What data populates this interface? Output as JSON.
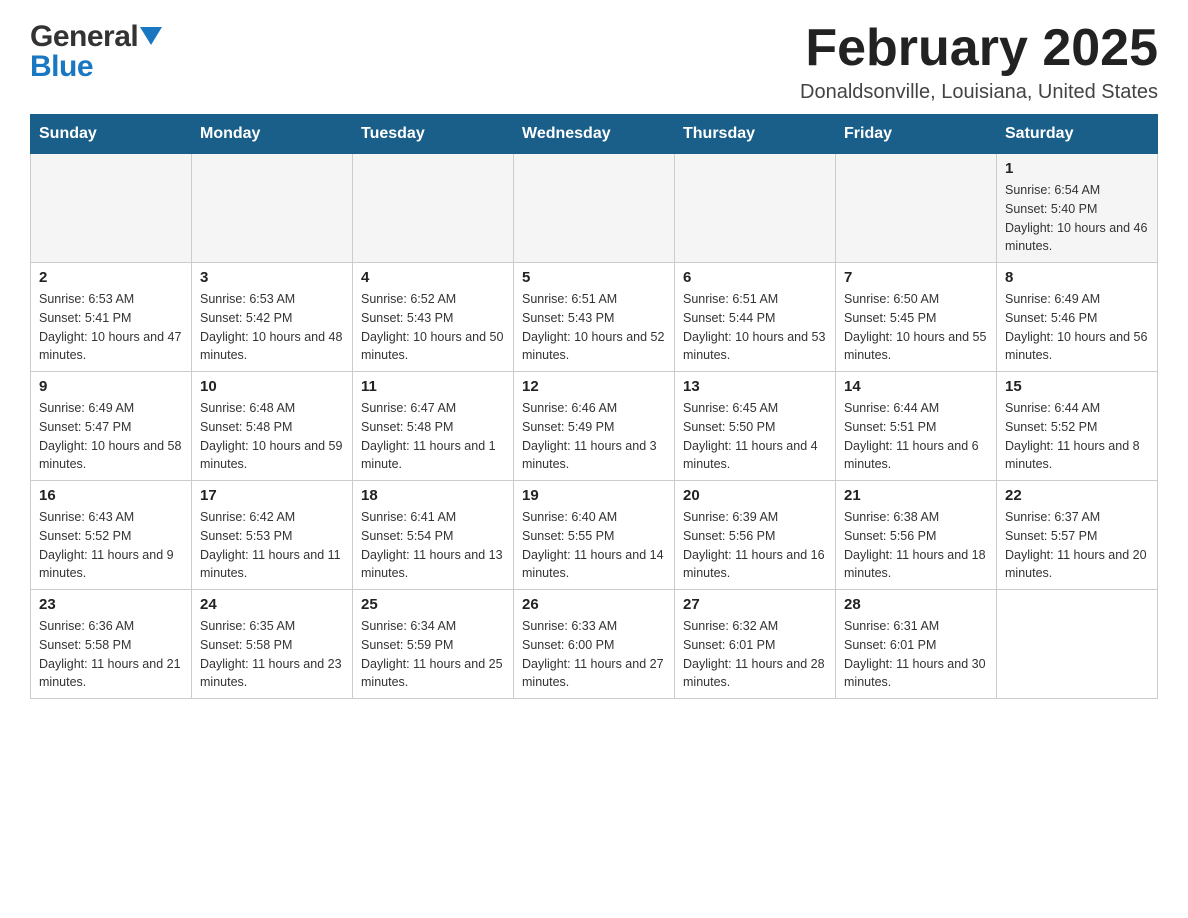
{
  "header": {
    "logo_general": "General",
    "logo_blue": "Blue",
    "title": "February 2025",
    "location": "Donaldsonville, Louisiana, United States"
  },
  "calendar": {
    "days_of_week": [
      "Sunday",
      "Monday",
      "Tuesday",
      "Wednesday",
      "Thursday",
      "Friday",
      "Saturday"
    ],
    "weeks": [
      {
        "cells": [
          {
            "day": null,
            "info": null
          },
          {
            "day": null,
            "info": null
          },
          {
            "day": null,
            "info": null
          },
          {
            "day": null,
            "info": null
          },
          {
            "day": null,
            "info": null
          },
          {
            "day": null,
            "info": null
          },
          {
            "day": "1",
            "info": "Sunrise: 6:54 AM\nSunset: 5:40 PM\nDaylight: 10 hours and 46 minutes."
          }
        ]
      },
      {
        "cells": [
          {
            "day": "2",
            "info": "Sunrise: 6:53 AM\nSunset: 5:41 PM\nDaylight: 10 hours and 47 minutes."
          },
          {
            "day": "3",
            "info": "Sunrise: 6:53 AM\nSunset: 5:42 PM\nDaylight: 10 hours and 48 minutes."
          },
          {
            "day": "4",
            "info": "Sunrise: 6:52 AM\nSunset: 5:43 PM\nDaylight: 10 hours and 50 minutes."
          },
          {
            "day": "5",
            "info": "Sunrise: 6:51 AM\nSunset: 5:43 PM\nDaylight: 10 hours and 52 minutes."
          },
          {
            "day": "6",
            "info": "Sunrise: 6:51 AM\nSunset: 5:44 PM\nDaylight: 10 hours and 53 minutes."
          },
          {
            "day": "7",
            "info": "Sunrise: 6:50 AM\nSunset: 5:45 PM\nDaylight: 10 hours and 55 minutes."
          },
          {
            "day": "8",
            "info": "Sunrise: 6:49 AM\nSunset: 5:46 PM\nDaylight: 10 hours and 56 minutes."
          }
        ]
      },
      {
        "cells": [
          {
            "day": "9",
            "info": "Sunrise: 6:49 AM\nSunset: 5:47 PM\nDaylight: 10 hours and 58 minutes."
          },
          {
            "day": "10",
            "info": "Sunrise: 6:48 AM\nSunset: 5:48 PM\nDaylight: 10 hours and 59 minutes."
          },
          {
            "day": "11",
            "info": "Sunrise: 6:47 AM\nSunset: 5:48 PM\nDaylight: 11 hours and 1 minute."
          },
          {
            "day": "12",
            "info": "Sunrise: 6:46 AM\nSunset: 5:49 PM\nDaylight: 11 hours and 3 minutes."
          },
          {
            "day": "13",
            "info": "Sunrise: 6:45 AM\nSunset: 5:50 PM\nDaylight: 11 hours and 4 minutes."
          },
          {
            "day": "14",
            "info": "Sunrise: 6:44 AM\nSunset: 5:51 PM\nDaylight: 11 hours and 6 minutes."
          },
          {
            "day": "15",
            "info": "Sunrise: 6:44 AM\nSunset: 5:52 PM\nDaylight: 11 hours and 8 minutes."
          }
        ]
      },
      {
        "cells": [
          {
            "day": "16",
            "info": "Sunrise: 6:43 AM\nSunset: 5:52 PM\nDaylight: 11 hours and 9 minutes."
          },
          {
            "day": "17",
            "info": "Sunrise: 6:42 AM\nSunset: 5:53 PM\nDaylight: 11 hours and 11 minutes."
          },
          {
            "day": "18",
            "info": "Sunrise: 6:41 AM\nSunset: 5:54 PM\nDaylight: 11 hours and 13 minutes."
          },
          {
            "day": "19",
            "info": "Sunrise: 6:40 AM\nSunset: 5:55 PM\nDaylight: 11 hours and 14 minutes."
          },
          {
            "day": "20",
            "info": "Sunrise: 6:39 AM\nSunset: 5:56 PM\nDaylight: 11 hours and 16 minutes."
          },
          {
            "day": "21",
            "info": "Sunrise: 6:38 AM\nSunset: 5:56 PM\nDaylight: 11 hours and 18 minutes."
          },
          {
            "day": "22",
            "info": "Sunrise: 6:37 AM\nSunset: 5:57 PM\nDaylight: 11 hours and 20 minutes."
          }
        ]
      },
      {
        "cells": [
          {
            "day": "23",
            "info": "Sunrise: 6:36 AM\nSunset: 5:58 PM\nDaylight: 11 hours and 21 minutes."
          },
          {
            "day": "24",
            "info": "Sunrise: 6:35 AM\nSunset: 5:58 PM\nDaylight: 11 hours and 23 minutes."
          },
          {
            "day": "25",
            "info": "Sunrise: 6:34 AM\nSunset: 5:59 PM\nDaylight: 11 hours and 25 minutes."
          },
          {
            "day": "26",
            "info": "Sunrise: 6:33 AM\nSunset: 6:00 PM\nDaylight: 11 hours and 27 minutes."
          },
          {
            "day": "27",
            "info": "Sunrise: 6:32 AM\nSunset: 6:01 PM\nDaylight: 11 hours and 28 minutes."
          },
          {
            "day": "28",
            "info": "Sunrise: 6:31 AM\nSunset: 6:01 PM\nDaylight: 11 hours and 30 minutes."
          },
          {
            "day": null,
            "info": null
          }
        ]
      }
    ]
  }
}
